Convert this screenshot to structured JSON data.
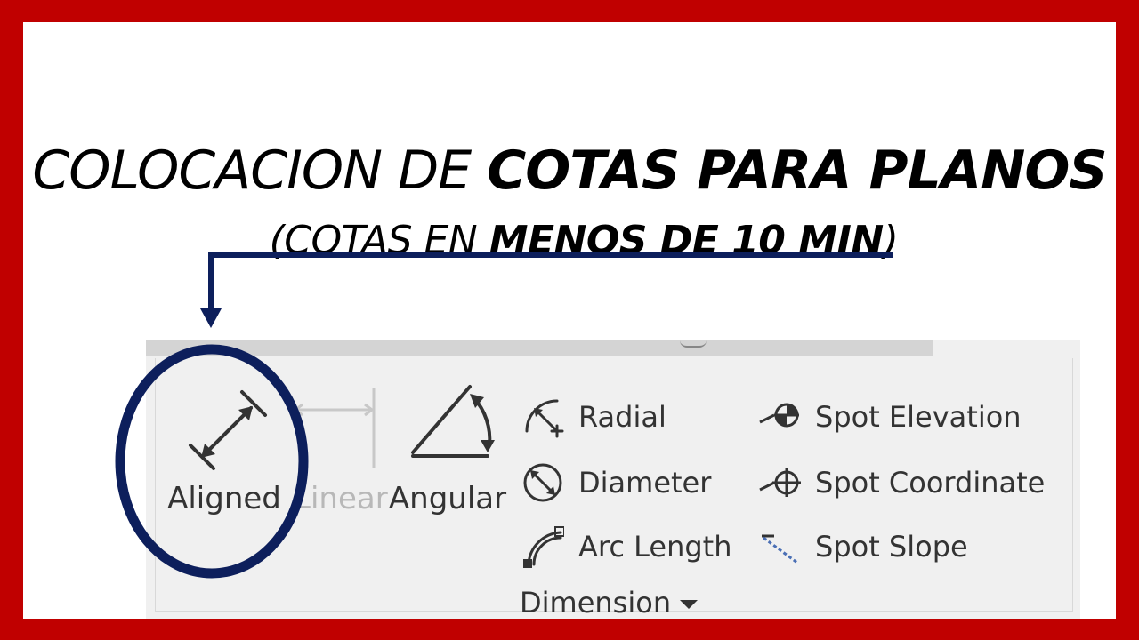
{
  "title": {
    "line1_normal": "COLOCACION DE ",
    "line1_bold": "COTAS PARA PLANOS",
    "line2_open": "(COTAS EN ",
    "line2_bold": "MENOS DE 10 MIN",
    "line2_close": ")"
  },
  "ribbon": {
    "buttons": {
      "aligned": "Aligned",
      "linear": "Linear",
      "angular": "Angular"
    },
    "dimension_items": {
      "radial": "Radial",
      "diameter": "Diameter",
      "arc_length": "Arc  Length"
    },
    "spot_items": {
      "elevation": "Spot  Elevation",
      "coordinate": "Spot  Coordinate",
      "slope": "Spot  Slope"
    },
    "panel_label": "Dimension"
  },
  "colors": {
    "border": "#c00000",
    "annotation": "#0d1f5c",
    "ribbon_bg": "#f0f0f0"
  },
  "icons": [
    "aligned-icon",
    "linear-icon",
    "angular-icon",
    "radial-icon",
    "diameter-icon",
    "arc-length-icon",
    "spot-elevation-icon",
    "spot-coordinate-icon",
    "spot-slope-icon",
    "chevron-down-icon"
  ]
}
